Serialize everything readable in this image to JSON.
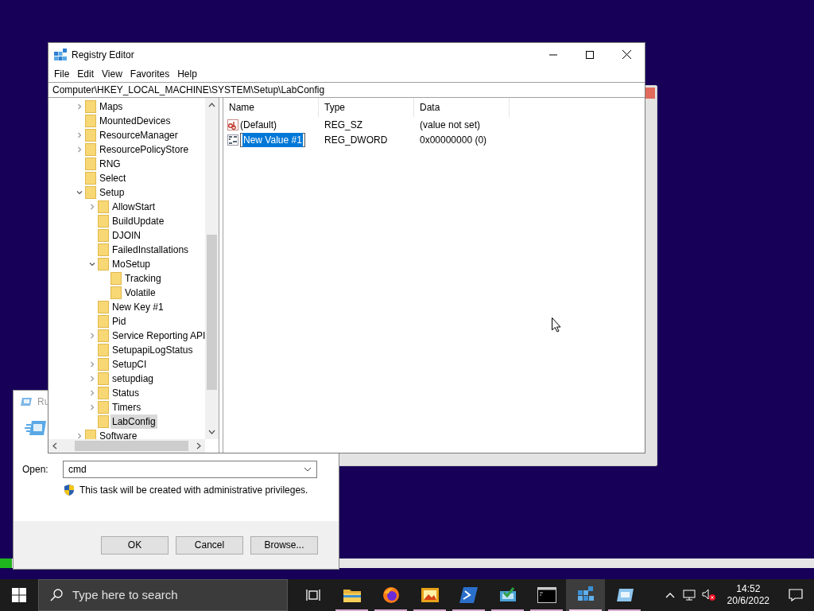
{
  "registry_editor": {
    "title": "Registry Editor",
    "menu": [
      "File",
      "Edit",
      "View",
      "Favorites",
      "Help"
    ],
    "address": "Computer\\HKEY_LOCAL_MACHINE\\SYSTEM\\Setup\\LabConfig",
    "tree": [
      {
        "label": "Maps",
        "expandable": true,
        "expanded": false,
        "selected": false
      },
      {
        "label": "MountedDevices",
        "expandable": false,
        "expanded": false,
        "selected": false
      },
      {
        "label": "ResourceManager",
        "expandable": true,
        "expanded": false,
        "selected": false
      },
      {
        "label": "ResourcePolicyStore",
        "expandable": true,
        "expanded": false,
        "selected": false
      },
      {
        "label": "RNG",
        "expandable": false,
        "expanded": false,
        "selected": false
      },
      {
        "label": "Select",
        "expandable": false,
        "expanded": false,
        "selected": false
      },
      {
        "label": "Setup",
        "expandable": true,
        "expanded": true,
        "selected": false,
        "children": [
          {
            "label": "AllowStart",
            "expandable": true,
            "expanded": false,
            "selected": false
          },
          {
            "label": "BuildUpdate",
            "expandable": false,
            "expanded": false,
            "selected": false
          },
          {
            "label": "DJOIN",
            "expandable": false,
            "expanded": false,
            "selected": false
          },
          {
            "label": "FailedInstallations",
            "expandable": false,
            "expanded": false,
            "selected": false
          },
          {
            "label": "MoSetup",
            "expandable": true,
            "expanded": true,
            "selected": false,
            "children": [
              {
                "label": "Tracking",
                "expandable": false,
                "expanded": false,
                "selected": false
              },
              {
                "label": "Volatile",
                "expandable": false,
                "expanded": false,
                "selected": false
              }
            ]
          },
          {
            "label": "New Key #1",
            "expandable": false,
            "expanded": false,
            "selected": false
          },
          {
            "label": "Pid",
            "expandable": false,
            "expanded": false,
            "selected": false
          },
          {
            "label": "Service Reporting API",
            "expandable": true,
            "expanded": false,
            "selected": false
          },
          {
            "label": "SetupapiLogStatus",
            "expandable": false,
            "expanded": false,
            "selected": false
          },
          {
            "label": "SetupCI",
            "expandable": true,
            "expanded": false,
            "selected": false
          },
          {
            "label": "setupdiag",
            "expandable": true,
            "expanded": false,
            "selected": false
          },
          {
            "label": "Status",
            "expandable": true,
            "expanded": false,
            "selected": false
          },
          {
            "label": "Timers",
            "expandable": true,
            "expanded": false,
            "selected": false
          },
          {
            "label": "LabConfig",
            "expandable": false,
            "expanded": false,
            "selected": true
          }
        ]
      },
      {
        "label": "Software",
        "expandable": true,
        "expanded": false,
        "selected": false
      }
    ],
    "columns": [
      "Name",
      "Type",
      "Data"
    ],
    "values": [
      {
        "kind": "string",
        "name": "(Default)",
        "type": "REG_SZ",
        "data": "(value not set)",
        "editing": false
      },
      {
        "kind": "binary",
        "name": "New Value #1",
        "type": "REG_DWORD",
        "data": "0x00000000 (0)",
        "editing": true
      }
    ]
  },
  "run_dialog": {
    "title": "Ru",
    "open_label": "Open:",
    "command": "cmd",
    "notice": "This task will be created with administrative privileges.",
    "buttons": [
      "OK",
      "Cancel",
      "Browse..."
    ]
  },
  "taskbar": {
    "search_placeholder": "Type here to search",
    "apps": [
      {
        "kind": "explorer",
        "running": true,
        "active": false
      },
      {
        "kind": "firefox",
        "running": true,
        "active": false
      },
      {
        "kind": "photos",
        "running": true,
        "active": false
      },
      {
        "kind": "powershell",
        "running": true,
        "active": false
      },
      {
        "kind": "installer",
        "running": true,
        "active": false
      },
      {
        "kind": "cmd",
        "running": true,
        "active": false
      },
      {
        "kind": "regedit",
        "running": true,
        "active": true
      },
      {
        "kind": "run",
        "running": true,
        "active": false
      }
    ],
    "time": "14:52",
    "date": "20/6/2022"
  }
}
